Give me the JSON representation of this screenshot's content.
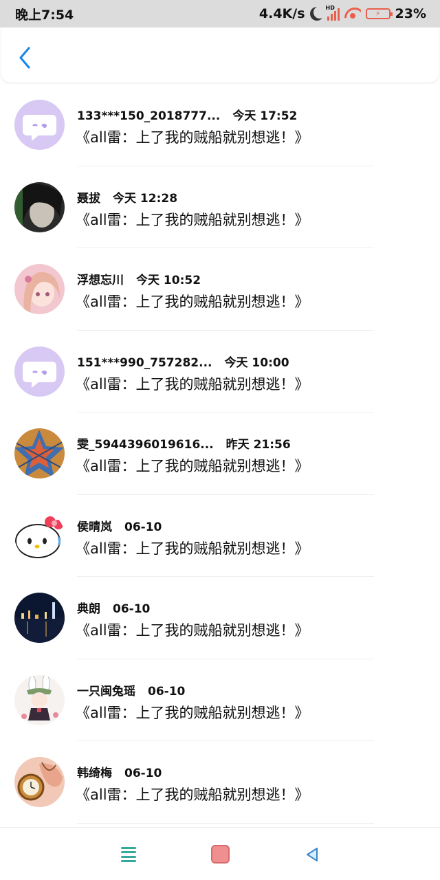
{
  "status_bar": {
    "time": "晚上7:54",
    "net_speed": "4.4K/s",
    "hd_label": "HD",
    "battery": "23%"
  },
  "colors": {
    "accent_blue": "#1e88e5",
    "status_icon": "#e8604c",
    "nav_menu": "#35a89c",
    "nav_home": "#f08f8f"
  },
  "items": [
    {
      "name": "133***150_2018777...",
      "time": "今天 17:52",
      "text": "《all雷：上了我的贼船就别想逃！》",
      "avatar": "default-chat-avatar"
    },
    {
      "name": "聂拔",
      "time": "今天 12:28",
      "text": "《all雷：上了我的贼船就别想逃！》",
      "avatar": "dark-hair-avatar"
    },
    {
      "name": "浮想忘川",
      "time": "今天 10:52",
      "text": "《all雷：上了我的贼船就别想逃！》",
      "avatar": "anime-girl-avatar"
    },
    {
      "name": "151***990_757282...",
      "time": "今天 10:00",
      "text": "《all雷：上了我的贼船就别想逃！》",
      "avatar": "default-chat-avatar"
    },
    {
      "name": "雯_5944396019616...",
      "time": "昨天 21:56",
      "text": "《all雷：上了我的贼船就别想逃！》",
      "avatar": "star-avatar"
    },
    {
      "name": "侯晴岚",
      "time": "06-10",
      "text": "《all雷：上了我的贼船就别想逃！》",
      "avatar": "hello-kitty-avatar"
    },
    {
      "name": "典朗",
      "time": "06-10",
      "text": "《all雷：上了我的贼船就别想逃！》",
      "avatar": "night-city-avatar"
    },
    {
      "name": "一只闽兔瑶",
      "time": "06-10",
      "text": "《all雷：上了我的贼船就别想逃！》",
      "avatar": "bunny-girl-avatar"
    },
    {
      "name": "韩绮梅",
      "time": "06-10",
      "text": "《all雷：上了我的贼船就别想逃！》",
      "avatar": "pocket-watch-avatar"
    }
  ]
}
